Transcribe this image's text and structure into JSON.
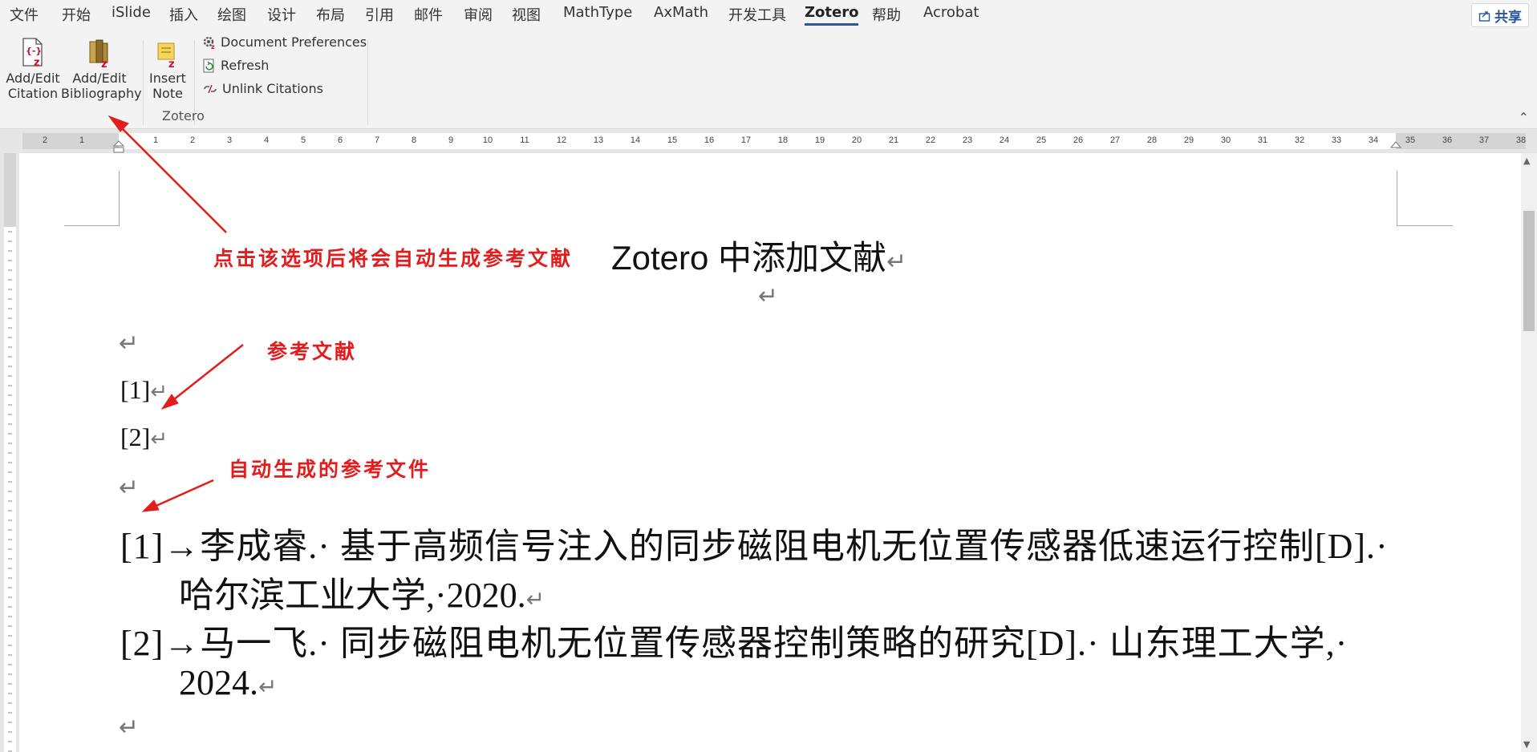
{
  "ribbon_tabs": [
    "文件",
    "开始",
    "iSlide",
    "插入",
    "绘图",
    "设计",
    "布局",
    "引用",
    "邮件",
    "审阅",
    "视图",
    "MathType",
    "AxMath",
    "开发工具",
    "Zotero",
    "帮助",
    "Acrobat"
  ],
  "active_tab": "Zotero",
  "share_label": "共享",
  "zotero_group": {
    "label": "Zotero",
    "add_edit_citation": [
      "Add/Edit",
      "Citation"
    ],
    "add_edit_bibliography": [
      "Add/Edit",
      "Bibliography"
    ],
    "insert_note": [
      "Insert",
      "Note"
    ],
    "document_preferences": "Document Preferences",
    "refresh": "Refresh",
    "unlink_citations": "Unlink Citations"
  },
  "ruler": {
    "left_ticks": [
      "2",
      "1"
    ],
    "ticks": [
      "1",
      "2",
      "3",
      "4",
      "5",
      "6",
      "7",
      "8",
      "9",
      "10",
      "11",
      "12",
      "13",
      "14",
      "15",
      "16",
      "17",
      "18",
      "19",
      "20",
      "21",
      "22",
      "23",
      "24",
      "25",
      "26",
      "27",
      "28",
      "29",
      "30",
      "31",
      "32",
      "33",
      "34",
      "35",
      "36",
      "37",
      "38"
    ]
  },
  "document": {
    "title": "Zotero 中添加文献",
    "citations": [
      "[1]",
      "[2]"
    ],
    "references": [
      {
        "line1": "[1]→李成睿.· 基于高频信号注入的同步磁阻电机无位置传感器低速运行控制[D].·",
        "line2": "哈尔滨工业大学,·2020."
      },
      {
        "line1": "[2]→马一飞.· 同步磁阻电机无位置传感器控制策略的研究[D].· 山东理工大学,·",
        "line2": "2024."
      }
    ],
    "paragraph_mark": "↵"
  },
  "annotations": {
    "bibliography_hint": "点击该选项后将会自动生成参考文献",
    "citation_label": "参考文献",
    "auto_generated": "自动生成的参考文件"
  },
  "colors": {
    "annotation_red": "#e31d1d",
    "active_tab_underline": "#2b579a"
  }
}
